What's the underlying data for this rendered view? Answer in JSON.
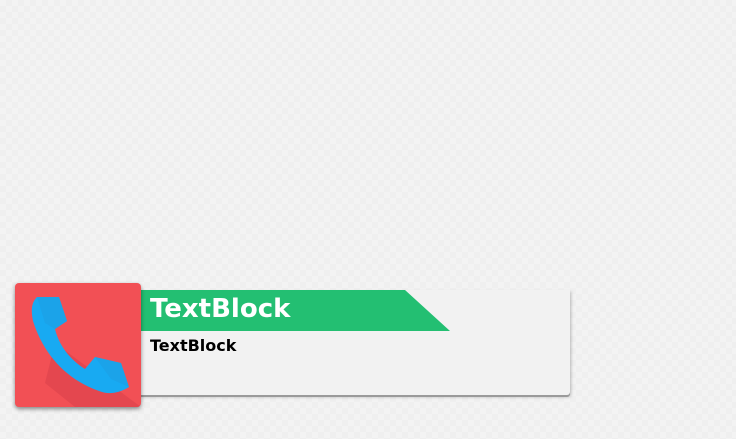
{
  "notification": {
    "title": "TextBlock",
    "body": "TextBlock",
    "icon": "phone-icon"
  },
  "colors": {
    "banner": "#23bf72",
    "tile": "#f25055",
    "phone": "#18aaf2",
    "card": "#f2f2f2"
  }
}
